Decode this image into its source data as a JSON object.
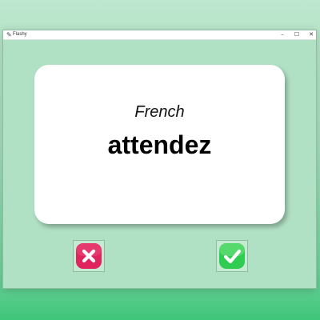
{
  "window": {
    "title": "Flashy",
    "controls": {
      "minimize": "–",
      "maximize": "☐",
      "close": "✕"
    }
  },
  "card": {
    "language": "French",
    "word": "attendez"
  },
  "buttons": {
    "wrong_icon": "cross-icon",
    "right_icon": "check-icon"
  },
  "colors": {
    "window_bg": "#b1e1c5",
    "wrong": "#e0245e",
    "right": "#2ecc51"
  }
}
